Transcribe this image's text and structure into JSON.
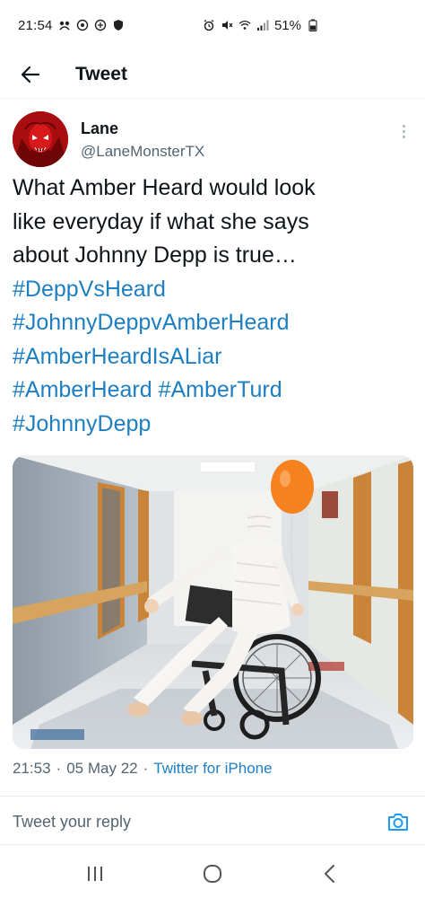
{
  "status_bar": {
    "time": "21:54",
    "battery": "51%",
    "icons_left": [
      "notification-icon",
      "sync-icon",
      "camera-status-icon",
      "shield-icon"
    ],
    "icons_right": [
      "alarm-icon",
      "mute-icon",
      "wifi-icon",
      "signal-icon",
      "battery-icon"
    ]
  },
  "header": {
    "title": "Tweet",
    "back_icon": "back-arrow-icon"
  },
  "tweet": {
    "author": {
      "display_name": "Lane",
      "handle": "@LaneMonsterTX"
    },
    "text_lines": [
      "What Amber Heard would look",
      "like everyday if what she says",
      "about Johnny Depp is true…"
    ],
    "hashtags": [
      "#DeppVsHeard",
      "#JohnnyDeppvAmberHeard",
      "#AmberHeardIsALiar",
      "#AmberHeard",
      "#AmberTurd",
      "#JohnnyDepp"
    ],
    "time": "21:53",
    "date": "05 May 22",
    "source": "Twitter for iPhone",
    "separator": "·"
  },
  "reply": {
    "placeholder": "Tweet your reply",
    "camera_icon": "camera-icon"
  },
  "nav": {
    "icons": [
      "recent-apps-icon",
      "home-icon",
      "back-icon"
    ]
  },
  "colors": {
    "link": "#1d7ec2",
    "text": "#0f1419",
    "secondary": "#536471",
    "balloon": "#f5811f"
  }
}
